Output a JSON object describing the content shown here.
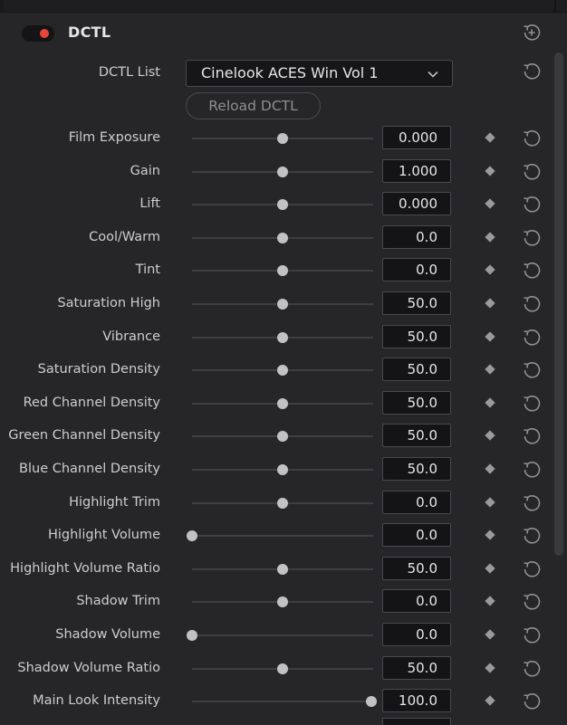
{
  "panel": {
    "title": "DCTL",
    "enabled": true,
    "accent_color": "#e8453c"
  },
  "dctl_list": {
    "label": "DCTL List",
    "selected": "Cinelook ACES Win Vol 1"
  },
  "reload_button": {
    "label": "Reload DCTL"
  },
  "params": [
    {
      "label": "Film Exposure",
      "value": "0.000",
      "slider_fraction": 0.5
    },
    {
      "label": "Gain",
      "value": "1.000",
      "slider_fraction": 0.5
    },
    {
      "label": "Lift",
      "value": "0.000",
      "slider_fraction": 0.5
    },
    {
      "label": "Cool/Warm",
      "value": "0.0",
      "slider_fraction": 0.5
    },
    {
      "label": "Tint",
      "value": "0.0",
      "slider_fraction": 0.5
    },
    {
      "label": "Saturation High",
      "value": "50.0",
      "slider_fraction": 0.5
    },
    {
      "label": "Vibrance",
      "value": "50.0",
      "slider_fraction": 0.5
    },
    {
      "label": "Saturation Density",
      "value": "50.0",
      "slider_fraction": 0.5
    },
    {
      "label": "Red Channel Density",
      "value": "50.0",
      "slider_fraction": 0.5
    },
    {
      "label": "Green Channel Density",
      "value": "50.0",
      "slider_fraction": 0.5
    },
    {
      "label": "Blue Channel Density",
      "value": "50.0",
      "slider_fraction": 0.5
    },
    {
      "label": "Highlight Trim",
      "value": "0.0",
      "slider_fraction": 0.5
    },
    {
      "label": "Highlight Volume",
      "value": "0.0",
      "slider_fraction": 0.0
    },
    {
      "label": "Highlight Volume Ratio",
      "value": "50.0",
      "slider_fraction": 0.5
    },
    {
      "label": "Shadow Trim",
      "value": "0.0",
      "slider_fraction": 0.5
    },
    {
      "label": "Shadow Volume",
      "value": "0.0",
      "slider_fraction": 0.0
    },
    {
      "label": "Shadow Volume Ratio",
      "value": "50.0",
      "slider_fraction": 0.5
    },
    {
      "label": "Main Look Intensity",
      "value": "100.0",
      "slider_fraction": 0.99
    }
  ],
  "icons": {
    "header_reset": "reset-all-icon",
    "row_reset": "reset-icon",
    "keyframe": "keyframe-diamond-icon",
    "dropdown": "chevron-down-icon"
  }
}
